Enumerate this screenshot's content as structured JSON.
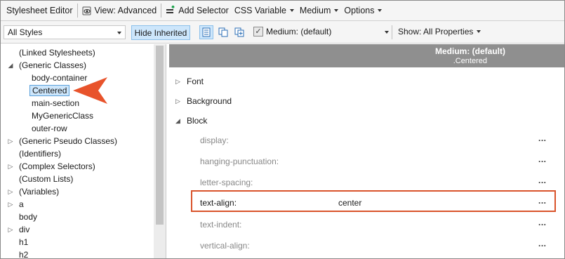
{
  "toolbar": {
    "title": "Stylesheet Editor",
    "view_label": "View: Advanced",
    "add_selector_label": "Add Selector",
    "css_variable_label": "CSS Variable",
    "medium_label": "Medium",
    "options_label": "Options"
  },
  "filterbar": {
    "styles_filter": "All Styles",
    "hide_inherited_label": "Hide Inherited",
    "medium_checked": true,
    "medium_value": "Medium: (default)",
    "show_properties": "Show: All Properties"
  },
  "tree": {
    "items": [
      {
        "label": "(Linked Stylesheets)",
        "toggle": ""
      },
      {
        "label": "(Generic Classes)",
        "toggle": "expanded"
      },
      {
        "label": "body-container",
        "toggle": ""
      },
      {
        "label": "Centered",
        "toggle": "",
        "selected": true
      },
      {
        "label": "main-section",
        "toggle": ""
      },
      {
        "label": "MyGenericClass",
        "toggle": ""
      },
      {
        "label": "outer-row",
        "toggle": ""
      },
      {
        "label": "(Generic Pseudo Classes)",
        "toggle": "collapsed"
      },
      {
        "label": "(Identifiers)",
        "toggle": ""
      },
      {
        "label": "(Complex Selectors)",
        "toggle": "collapsed"
      },
      {
        "label": "(Custom Lists)",
        "toggle": ""
      },
      {
        "label": "(Variables)",
        "toggle": "collapsed"
      },
      {
        "label": "a",
        "toggle": "collapsed"
      },
      {
        "label": "body",
        "toggle": ""
      },
      {
        "label": "div",
        "toggle": "collapsed"
      },
      {
        "label": "h1",
        "toggle": ""
      },
      {
        "label": "h2",
        "toggle": ""
      }
    ]
  },
  "properties": {
    "header_medium": "Medium: (default)",
    "header_selector": ".Centered",
    "sections": [
      {
        "label": "Font",
        "toggle": "collapsed"
      },
      {
        "label": "Background",
        "toggle": "collapsed"
      },
      {
        "label": "Block",
        "toggle": "expanded"
      }
    ],
    "block_properties": [
      {
        "name": "display:",
        "value": "",
        "more": "..."
      },
      {
        "name": "hanging-punctuation:",
        "value": "",
        "more": "..."
      },
      {
        "name": "letter-spacing:",
        "value": "",
        "more": "..."
      },
      {
        "name": "text-align:",
        "value": "center",
        "more": "...",
        "set": true
      },
      {
        "name": "text-indent:",
        "value": "",
        "more": "..."
      },
      {
        "name": "vertical-align:",
        "value": "",
        "more": "..."
      }
    ]
  },
  "colors": {
    "accent": "#cde6fb",
    "callout": "#e8532b",
    "highlight_border": "#d9532b",
    "header_bg": "#8f8f8f"
  }
}
